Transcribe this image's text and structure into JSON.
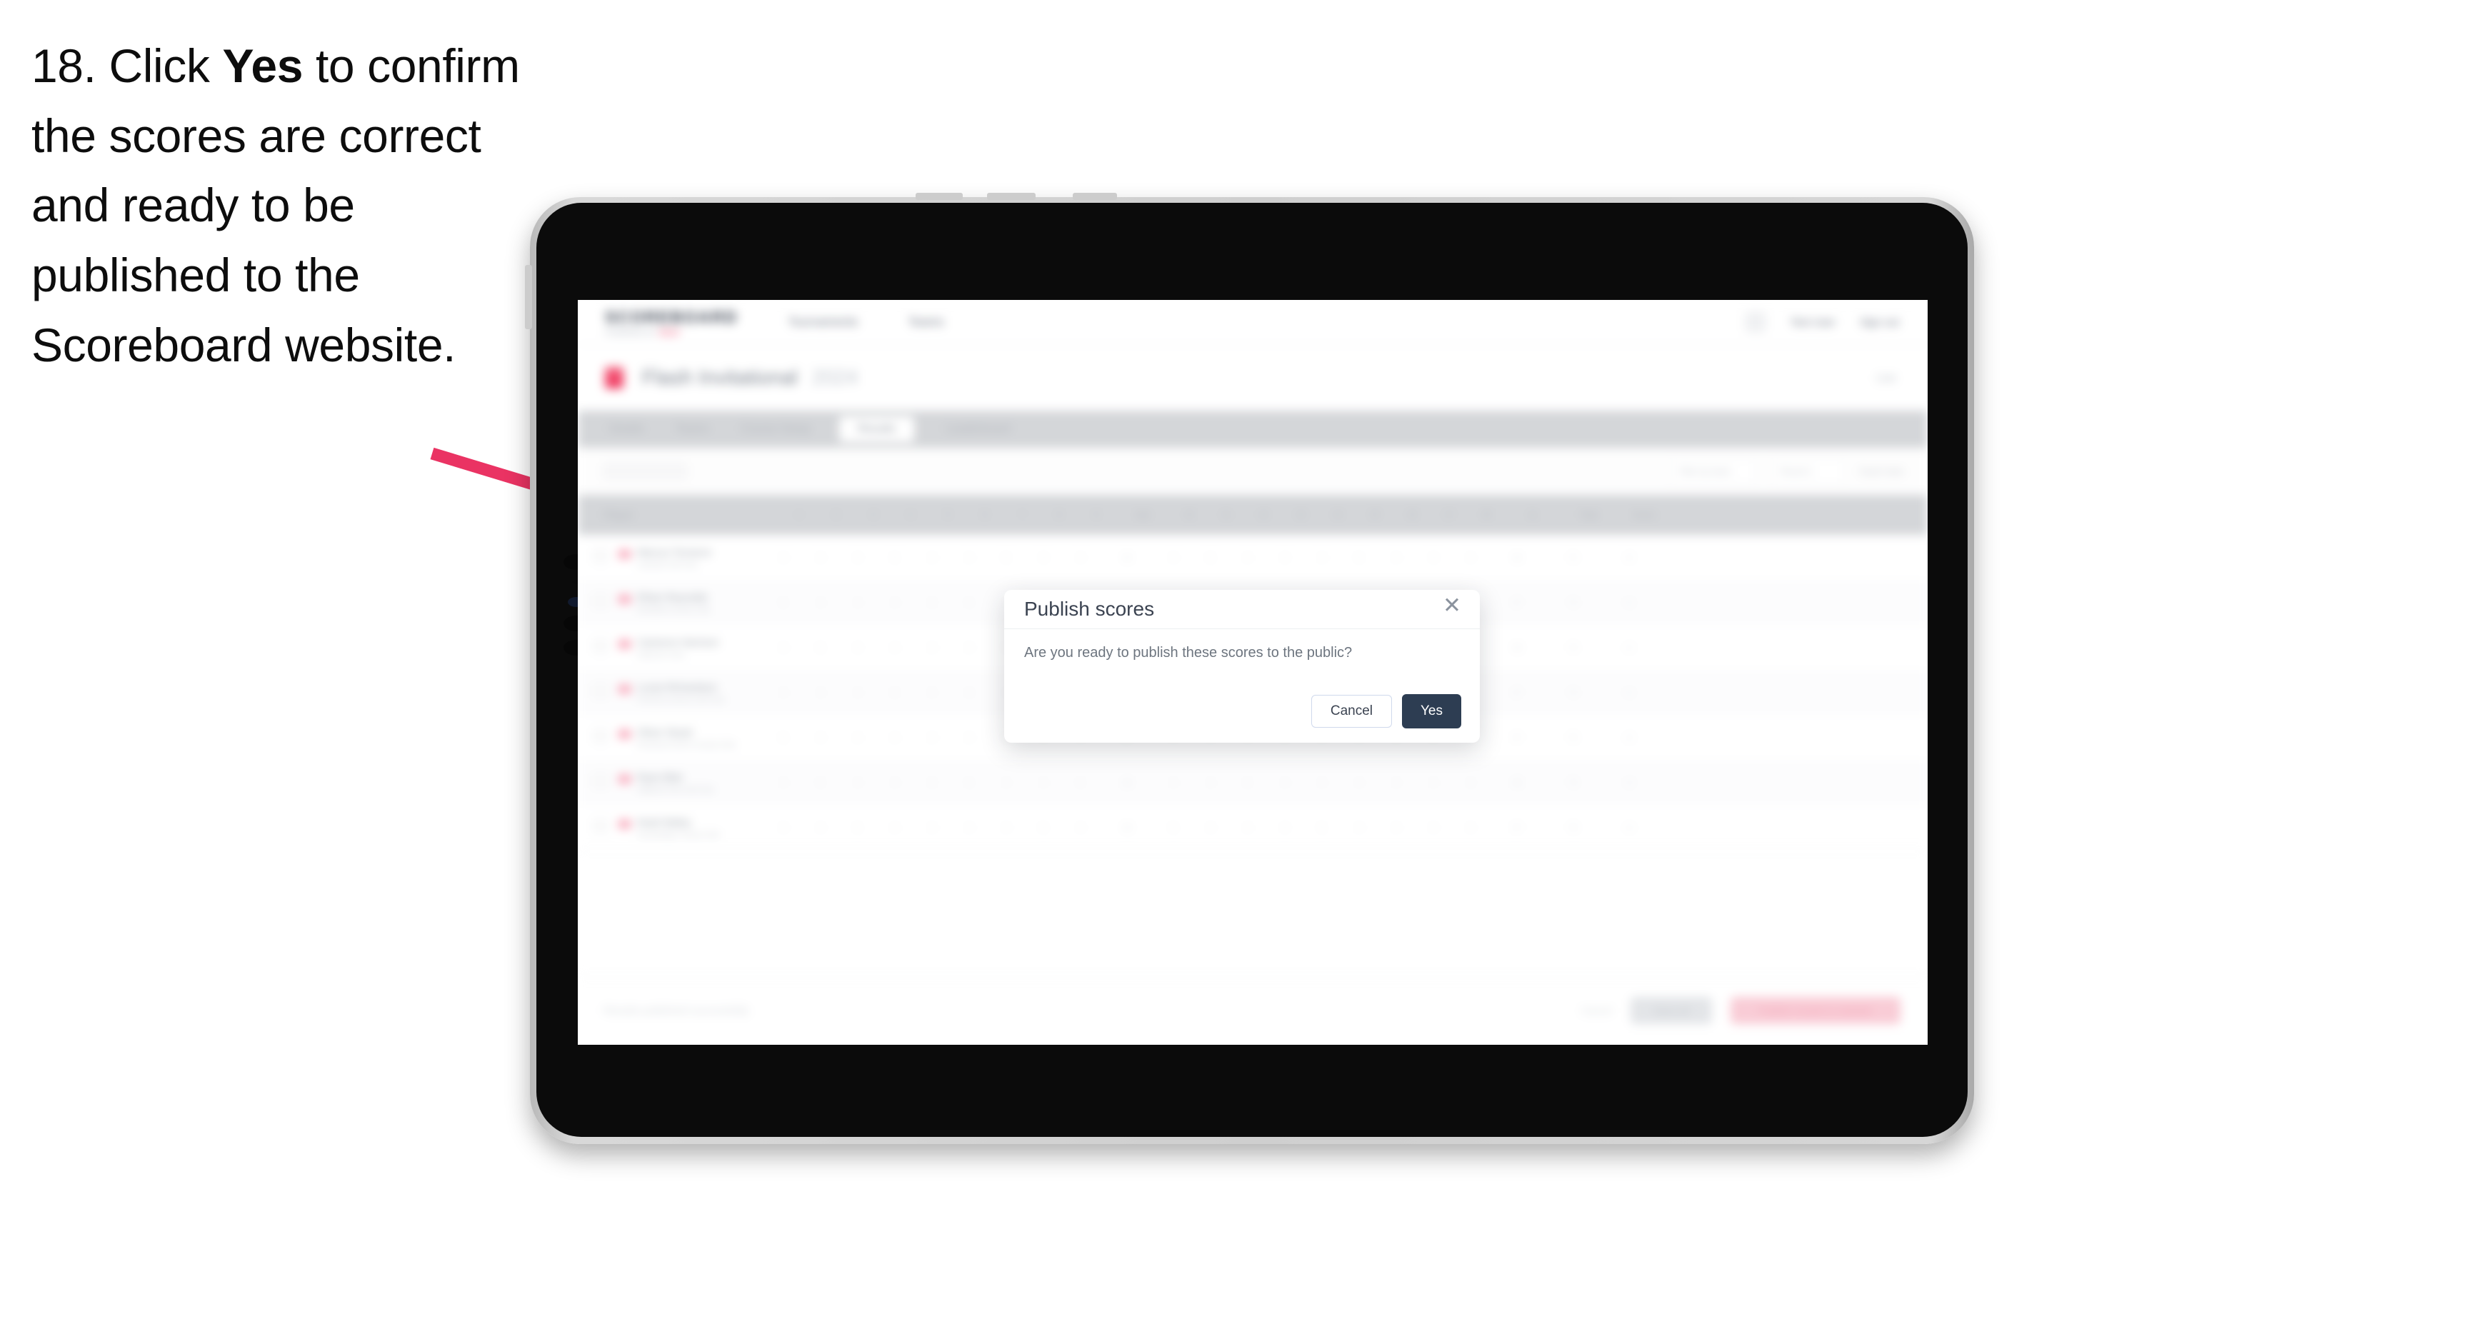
{
  "instruction": {
    "step_number": "18.",
    "text_before": " Click ",
    "bold_word": "Yes",
    "text_after": " to confirm the scores are correct and ready to be published to the Scoreboard website."
  },
  "colors": {
    "arrow": "#EA3363",
    "primary_button": "#2D3D52",
    "brand_accent": "#EE3B63"
  },
  "modal": {
    "title": "Publish scores",
    "close_icon": "close-icon",
    "body": "Are you ready to publish these scores to the public?",
    "cancel_label": "Cancel",
    "confirm_label": "Yes"
  },
  "app": {
    "header": {
      "logo": "SCOREBOARD",
      "sub_text": "POWERED BY",
      "sub_accent": "GOLF",
      "nav": [
        "Tournaments",
        "Teams"
      ],
      "account_icon": "user-avatar-icon",
      "account_label": "Test User",
      "signout_label": "Sign out"
    },
    "title_band": {
      "flag_icon": "country-flag-icon",
      "title": "Flash Invitational",
      "year": "2024",
      "status": "Live"
    },
    "tabs": [
      {
        "label": "Details",
        "active": false
      },
      {
        "label": "Teams",
        "active": false
      },
      {
        "label": "Course Setup",
        "active": false
      },
      {
        "label": "Results",
        "active": true
      },
      {
        "label": "Leaderboard",
        "active": false
      }
    ],
    "filters": {
      "search_placeholder": "Search",
      "dropdown_1": "Filter by team",
      "dropdown_2": "Round 1",
      "export_label": "Export data",
      "settings_icon": "gear-icon"
    },
    "table": {
      "headers": [
        "Player",
        "1",
        "2",
        "3",
        "4",
        "5",
        "6",
        "7",
        "8",
        "9",
        "Out",
        "10",
        "11",
        "12",
        "13",
        "14",
        "15",
        "16",
        "17",
        "18",
        "In",
        "Total",
        "Score"
      ],
      "rows": [
        {
          "name": "Marcus Torrance",
          "club": "Lakeside Golf Club",
          "scores": [
            "4",
            "4",
            "3",
            "5",
            "4",
            "4",
            "5",
            "3",
            "4",
            "36",
            "4",
            "5",
            "4",
            "3",
            "4",
            "5",
            "4",
            "3",
            "4",
            "36",
            "72",
            "+0"
          ]
        },
        {
          "name": "Ethan Reynolds",
          "club": "Westfield Country Club",
          "scores": [
            "5",
            "4",
            "4",
            "4",
            "3",
            "5",
            "4",
            "4",
            "4",
            "37",
            "4",
            "4",
            "5",
            "4",
            "3",
            "4",
            "5",
            "4",
            "4",
            "37",
            "74",
            "+2"
          ]
        },
        {
          "name": "Cameron Harrison",
          "club": "Oakmont Links",
          "scores": [
            "4",
            "5",
            "3",
            "4",
            "4",
            "4",
            "5",
            "4",
            "3",
            "36",
            "5",
            "4",
            "4",
            "4",
            "4",
            "3",
            "5",
            "4",
            "5",
            "38",
            "74",
            "+2"
          ]
        },
        {
          "name": "Lucas Richardson",
          "club": "Pinehurst Greens Golf Club",
          "scores": [
            "4",
            "4",
            "4",
            "5",
            "4",
            "3",
            "4",
            "5",
            "4",
            "37",
            "4",
            "5",
            "3",
            "4",
            "5",
            "4",
            "4",
            "4",
            "4",
            "37",
            "74",
            "+2"
          ]
        },
        {
          "name": "Oliver Stuart",
          "club": "Riverbend Golf & Country Club",
          "scores": [
            "5",
            "4",
            "4",
            "4",
            "4",
            "4",
            "5",
            "3",
            "4",
            "37",
            "4",
            "4",
            "4",
            "5",
            "4",
            "4",
            "3",
            "5",
            "4",
            "37",
            "75",
            "+3"
          ]
        },
        {
          "name": "Ryan Blair",
          "club": "Highland Park Golf Club",
          "scores": [
            "4",
            "5",
            "4",
            "4",
            "3",
            "5",
            "4",
            "4",
            "5",
            "38",
            "4",
            "4",
            "5",
            "4",
            "4",
            "4",
            "4",
            "4",
            "3",
            "36",
            "75",
            "+3"
          ]
        },
        {
          "name": "Noah Bailey",
          "club": "Stonebridge Country Club",
          "scores": [
            "4",
            "4",
            "5",
            "4",
            "4",
            "4",
            "4",
            "5",
            "4",
            "38",
            "5",
            "4",
            "4",
            "3",
            "5",
            "4",
            "4",
            "4",
            "4",
            "37",
            "76",
            "+4"
          ]
        }
      ]
    },
    "footer": {
      "note": "Results published successfully",
      "cancel_label": "Cancel",
      "save_label": "Save all",
      "publish_label": "Publish results to website"
    }
  }
}
